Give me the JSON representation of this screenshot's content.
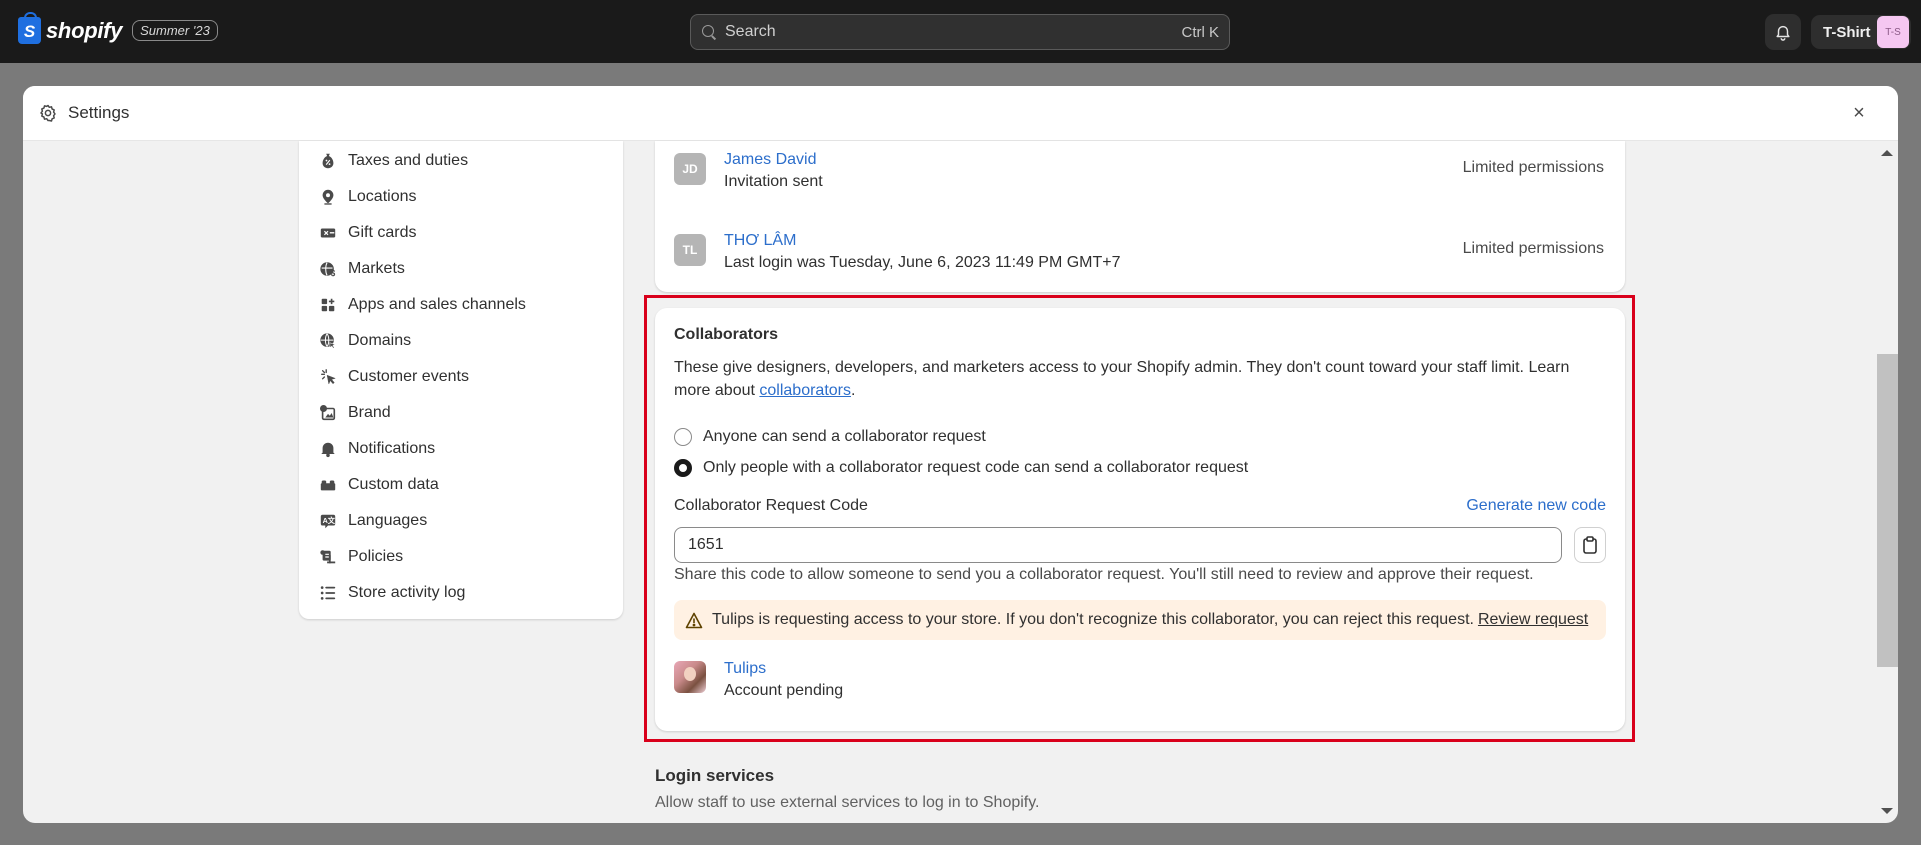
{
  "topbar": {
    "brand": "shopify",
    "edition_badge": "Summer '23",
    "search": {
      "placeholder": "Search",
      "shortcut": "Ctrl K"
    },
    "store": {
      "name": "T-Shirt",
      "avatar_initials": "T-S",
      "avatar_color": "#f5c7f1"
    }
  },
  "settings": {
    "title": "Settings",
    "close_label": "×"
  },
  "sidebar": {
    "items": [
      {
        "label": "Taxes and duties",
        "icon": "taxes-icon"
      },
      {
        "label": "Locations",
        "icon": "location-icon"
      },
      {
        "label": "Gift cards",
        "icon": "gift-card-icon"
      },
      {
        "label": "Markets",
        "icon": "markets-icon"
      },
      {
        "label": "Apps and sales channels",
        "icon": "apps-icon"
      },
      {
        "label": "Domains",
        "icon": "domains-icon"
      },
      {
        "label": "Customer events",
        "icon": "customer-events-icon"
      },
      {
        "label": "Brand",
        "icon": "brand-icon"
      },
      {
        "label": "Notifications",
        "icon": "notifications-icon"
      },
      {
        "label": "Custom data",
        "icon": "custom-data-icon"
      },
      {
        "label": "Languages",
        "icon": "languages-icon"
      },
      {
        "label": "Policies",
        "icon": "policies-icon"
      },
      {
        "label": "Store activity log",
        "icon": "activity-log-icon"
      }
    ]
  },
  "staff": [
    {
      "initials": "JD",
      "name": "James David",
      "status": "Invitation sent",
      "permissions": "Limited permissions"
    },
    {
      "initials": "TL",
      "name": "THƠ LÂM",
      "status": "Last login was Tuesday, June 6, 2023 11:49 PM GMT+7",
      "permissions": "Limited permissions"
    }
  ],
  "collaborators": {
    "title": "Collaborators",
    "description_before": "These give designers, developers, and marketers access to your Shopify admin. They don't count toward your staff limit. Learn more about ",
    "description_link": "collaborators",
    "description_after": ".",
    "options": [
      {
        "label": "Anyone can send a collaborator request",
        "checked": false
      },
      {
        "label": "Only people with a collaborator request code can send a collaborator request",
        "checked": true
      }
    ],
    "code_label": "Collaborator Request Code",
    "generate_label": "Generate new code",
    "code_value": "1651",
    "help_text": "Share this code to allow someone to send you a collaborator request. You'll still need to review and approve their request.",
    "banner": {
      "text": "Tulips is requesting access to your store. If you don't recognize this collaborator, you can reject this request.",
      "link": "Review request",
      "background": "#fff1e3"
    },
    "pending": {
      "name": "Tulips",
      "status": "Account pending"
    }
  },
  "login_services": {
    "title": "Login services",
    "description": "Allow staff to use external services to log in to Shopify."
  },
  "colors": {
    "link": "#2c6ecb",
    "highlight_border": "#d9001b",
    "topbar": "#1a1a1a"
  }
}
